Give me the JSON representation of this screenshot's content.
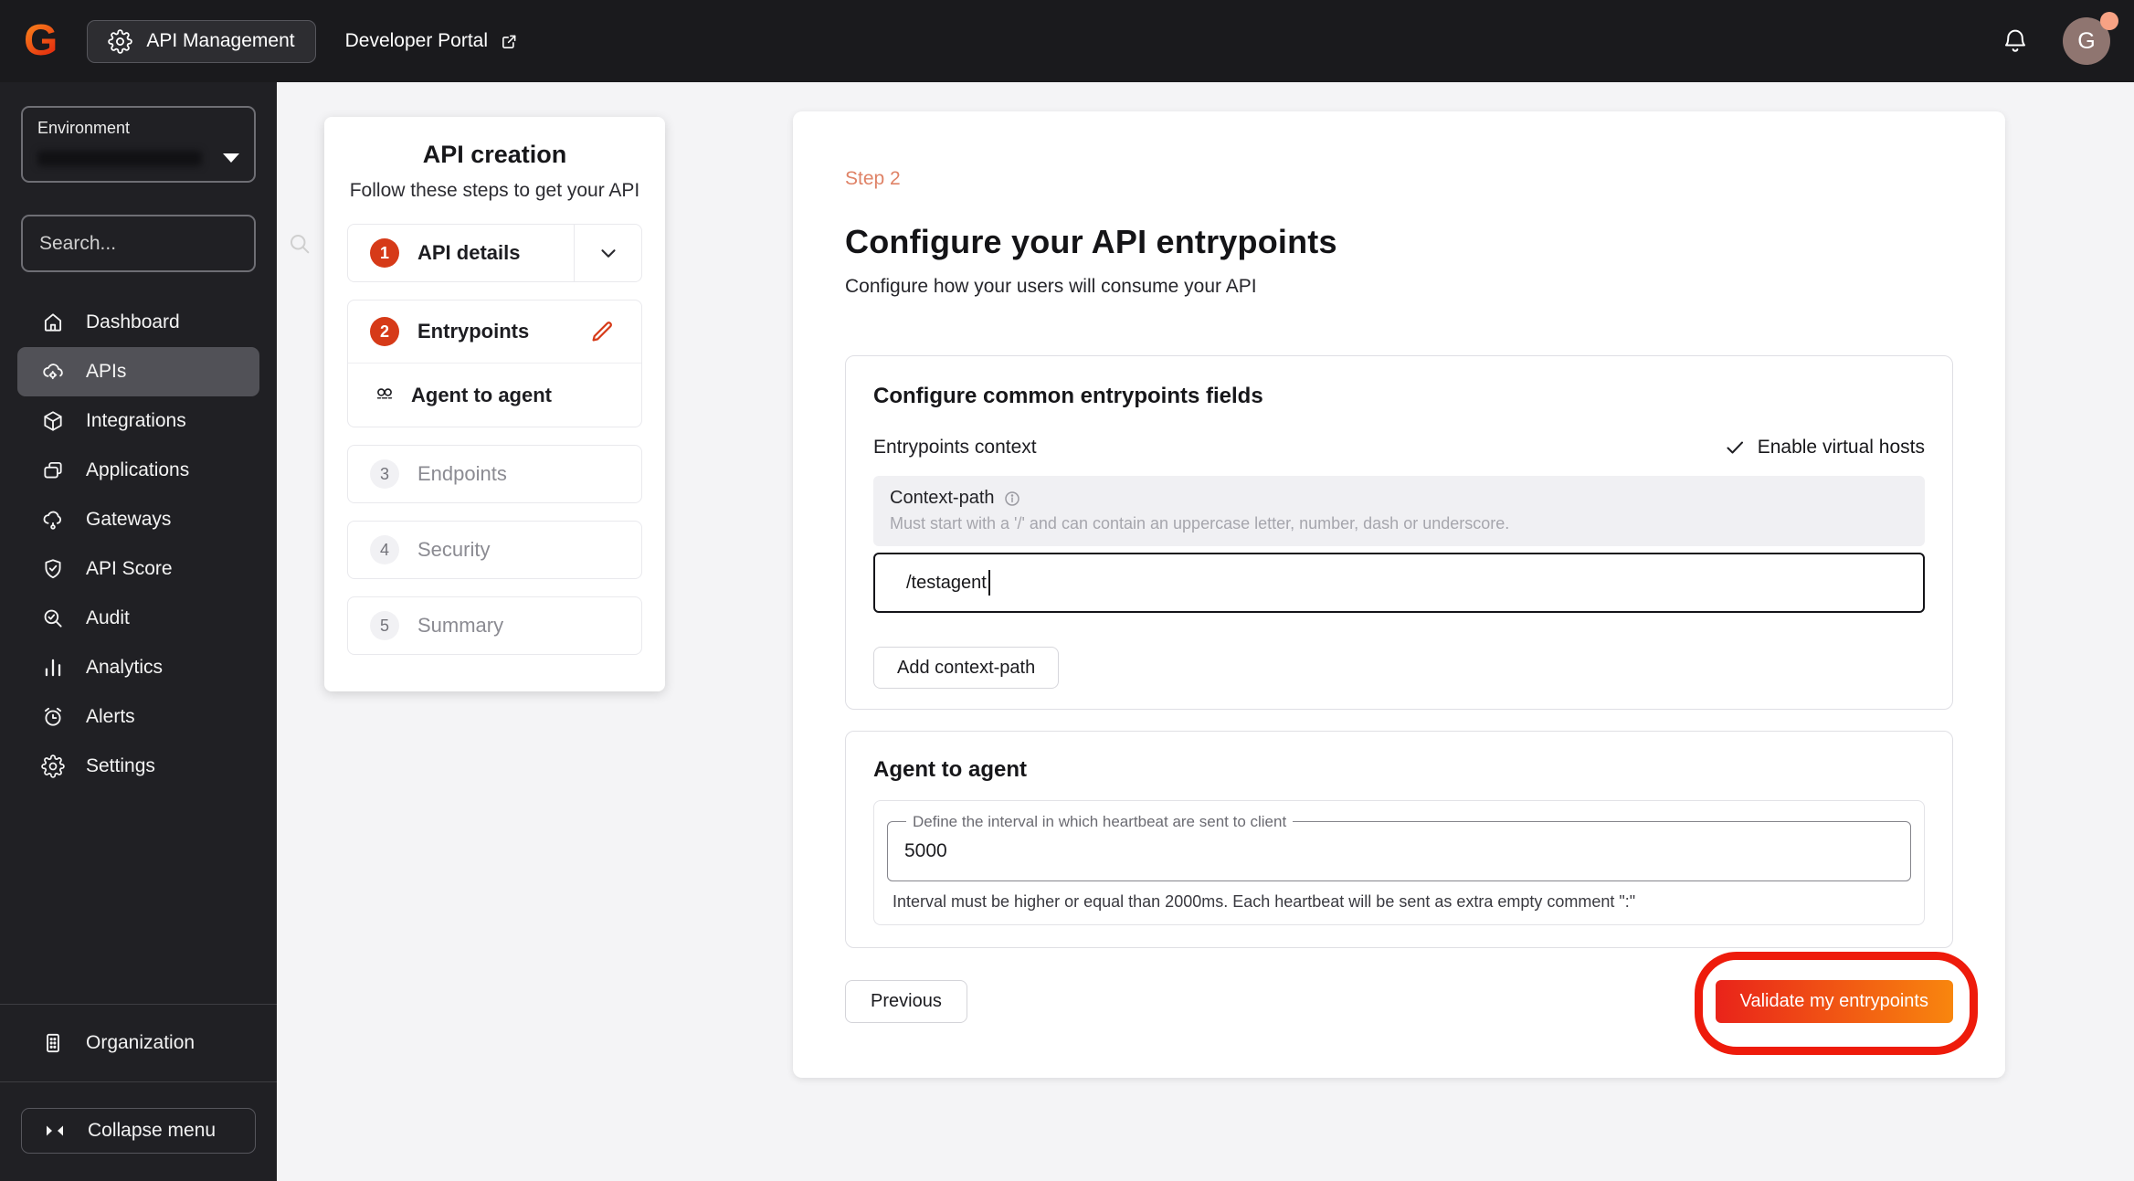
{
  "topbar": {
    "logo_letter": "G",
    "app_switcher_label": "API Management",
    "developer_portal_label": "Developer Portal",
    "avatar_initial": "G"
  },
  "sidebar": {
    "environment_label": "Environment",
    "search_placeholder": "Search...",
    "items": [
      {
        "label": "Dashboard",
        "icon": "home-icon",
        "active": false
      },
      {
        "label": "APIs",
        "icon": "cloud-gear-icon",
        "active": true
      },
      {
        "label": "Integrations",
        "icon": "cube-icon",
        "active": false
      },
      {
        "label": "Applications",
        "icon": "apps-icon",
        "active": false
      },
      {
        "label": "Gateways",
        "icon": "cloud-node-icon",
        "active": false
      },
      {
        "label": "API Score",
        "icon": "shield-check-icon",
        "active": false
      },
      {
        "label": "Audit",
        "icon": "search-check-icon",
        "active": false
      },
      {
        "label": "Analytics",
        "icon": "bar-chart-icon",
        "active": false
      },
      {
        "label": "Alerts",
        "icon": "alarm-clock-icon",
        "active": false
      },
      {
        "label": "Settings",
        "icon": "gear-icon",
        "active": false
      }
    ],
    "organization_label": "Organization",
    "collapse_label": "Collapse menu"
  },
  "stepper": {
    "title": "API creation",
    "subtitle": "Follow these steps to get your API",
    "steps": [
      {
        "number": "1",
        "label": "API details",
        "state": "done"
      },
      {
        "number": "2",
        "label": "Entrypoints",
        "state": "active",
        "sub_label": "Agent to agent"
      },
      {
        "number": "3",
        "label": "Endpoints",
        "state": "pending"
      },
      {
        "number": "4",
        "label": "Security",
        "state": "pending"
      },
      {
        "number": "5",
        "label": "Summary",
        "state": "pending"
      }
    ]
  },
  "main": {
    "step_tag": "Step 2",
    "title": "Configure your API entrypoints",
    "subtitle": "Configure how your users will consume your API",
    "card_common": {
      "title": "Configure common entrypoints fields",
      "context_label": "Entrypoints context",
      "virtual_hosts_label": "Enable virtual hosts",
      "field_label": "Context-path",
      "field_hint": "Must start with a '/' and can contain an uppercase letter, number, dash or underscore.",
      "field_value": "/testagent",
      "add_button_label": "Add context-path"
    },
    "card_agent": {
      "title": "Agent to agent",
      "field_label": "Define the interval in which heartbeat are sent to client",
      "field_value": "5000",
      "field_hint": "Interval must be higher or equal than 2000ms. Each heartbeat will be sent as extra empty comment \":\""
    },
    "footer": {
      "previous_label": "Previous",
      "validate_label": "Validate my entrypoints"
    }
  },
  "colors": {
    "accent_red_orange": "#d63a18",
    "step_tag_salmon": "#df8266",
    "validate_gradient_start": "#e9231a",
    "validate_gradient_end": "#f8860e",
    "annotation_red": "#ee1b0b",
    "avatar_bg": "#8f7570",
    "avatar_badge": "#f7a284",
    "sidebar_bg": "#202024",
    "topbar_bg": "#1a1a1d"
  }
}
